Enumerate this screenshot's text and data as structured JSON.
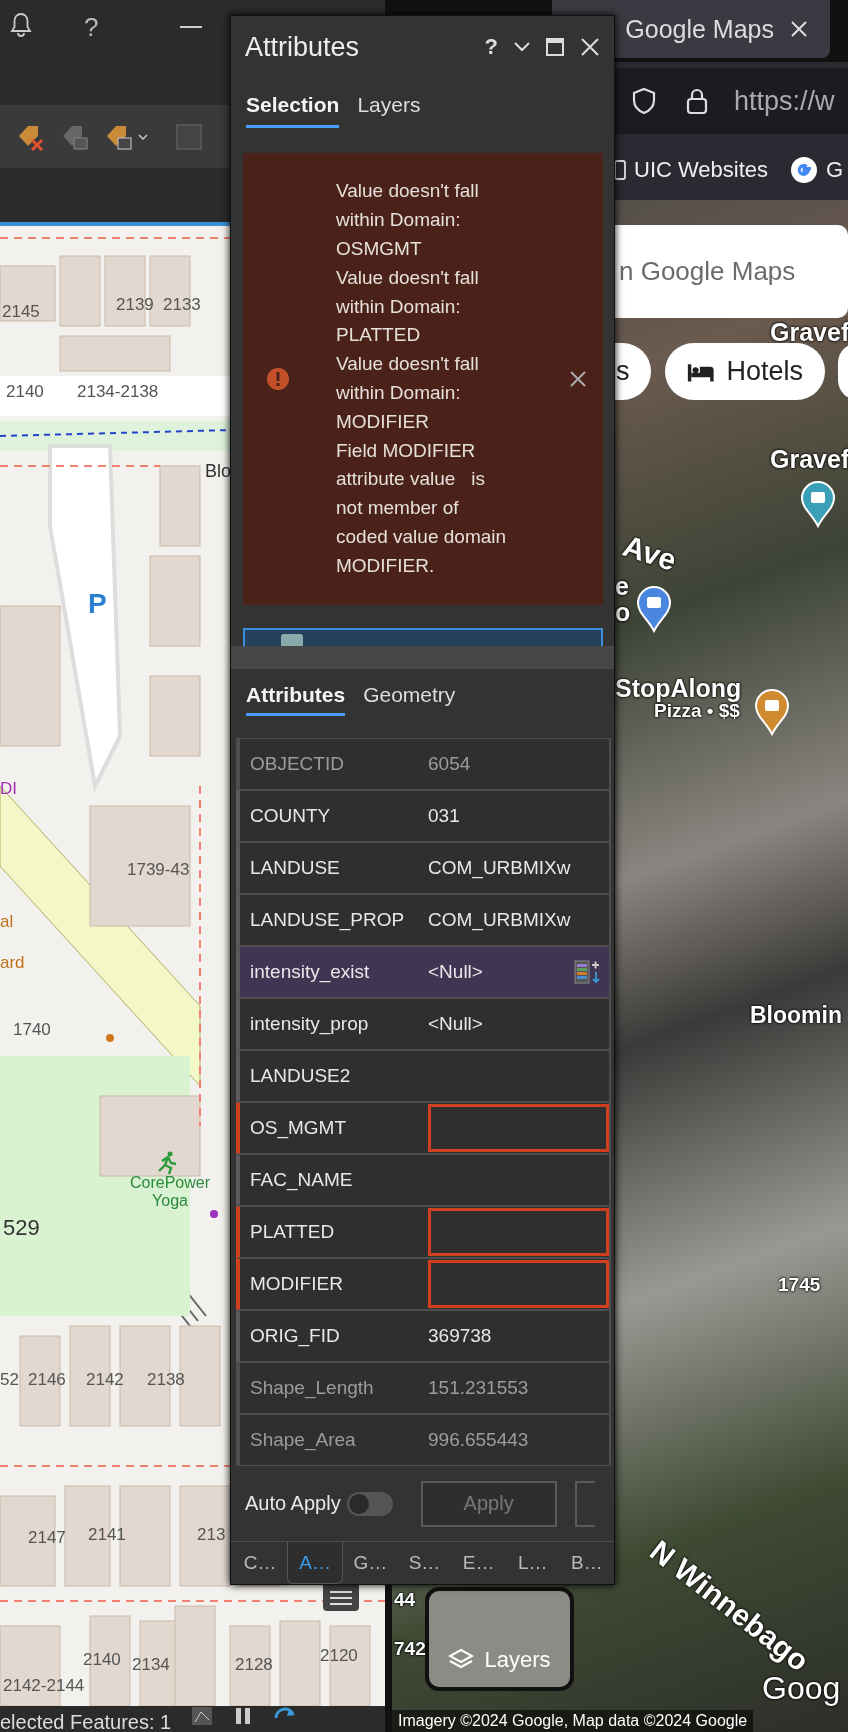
{
  "arcgis_pro": {
    "help": "?",
    "map_labels": [
      {
        "text": "2145",
        "kind": "address"
      },
      {
        "text": "2139",
        "kind": "address"
      },
      {
        "text": "2133",
        "kind": "address"
      },
      {
        "text": "2140",
        "kind": "address"
      },
      {
        "text": "2134-2138",
        "kind": "address"
      },
      {
        "text": "Blo",
        "kind": "road"
      },
      {
        "text": "P",
        "kind": "parking"
      },
      {
        "text": "DI",
        "kind": "store"
      },
      {
        "text": "1739-43",
        "kind": "address"
      },
      {
        "text": "al",
        "kind": "food"
      },
      {
        "text": "ard",
        "kind": "food"
      },
      {
        "text": "1740",
        "kind": "address"
      },
      {
        "text": "CorePower Yoga",
        "kind": "poi"
      },
      {
        "text": "529",
        "kind": "big"
      },
      {
        "text": "52",
        "kind": "address"
      },
      {
        "text": "2146",
        "kind": "address"
      },
      {
        "text": "2142",
        "kind": "address"
      },
      {
        "text": "2138",
        "kind": "address"
      },
      {
        "text": "2147",
        "kind": "address"
      },
      {
        "text": "2141",
        "kind": "address"
      },
      {
        "text": "213",
        "kind": "address"
      },
      {
        "text": "2140",
        "kind": "address"
      },
      {
        "text": "2134",
        "kind": "address"
      },
      {
        "text": "2128",
        "kind": "address"
      },
      {
        "text": "2120",
        "kind": "address"
      },
      {
        "text": "2142-2144",
        "kind": "address"
      }
    ],
    "status_bar": "elected Features: 1"
  },
  "attributes_pane": {
    "title": "Attributes",
    "help": "?",
    "tabs": [
      {
        "label": "Selection",
        "selected": true
      },
      {
        "label": "Layers",
        "selected": false
      }
    ],
    "error": {
      "lines": [
        "Value doesn't fall",
        "within Domain:",
        "OSMGMT",
        "Value doesn't fall",
        "within Domain:",
        "PLATTED",
        "Value doesn't fall",
        "within Domain:",
        "MODIFIER",
        "Field MODIFIER",
        "attribute value   is",
        "not member of",
        "coded value domain",
        "MODIFIER."
      ]
    },
    "detail_tabs": [
      {
        "label": "Attributes",
        "selected": true
      },
      {
        "label": "Geometry",
        "selected": false
      }
    ],
    "fields": [
      {
        "name": "OBJECTID",
        "value": "6054",
        "readonly": true,
        "invalid": false,
        "selected": false
      },
      {
        "name": "COUNTY",
        "value": "031",
        "readonly": false,
        "invalid": false,
        "selected": false
      },
      {
        "name": "LANDUSE",
        "value": "COM_URBMIXw",
        "readonly": false,
        "invalid": false,
        "selected": false
      },
      {
        "name": "LANDUSE_PROP",
        "value": "COM_URBMIXw",
        "readonly": false,
        "invalid": false,
        "selected": false
      },
      {
        "name": "intensity_exist",
        "value": "<Null>",
        "readonly": false,
        "invalid": false,
        "selected": true
      },
      {
        "name": "intensity_prop",
        "value": "<Null>",
        "readonly": false,
        "invalid": false,
        "selected": false
      },
      {
        "name": "LANDUSE2",
        "readonly": false,
        "invalid": false,
        "selected": false
      },
      {
        "name": "OS_MGMT",
        "readonly": false,
        "invalid": true,
        "selected": false
      },
      {
        "name": "FAC_NAME",
        "readonly": false,
        "invalid": false,
        "selected": false
      },
      {
        "name": "PLATTED",
        "readonly": false,
        "invalid": true,
        "selected": false
      },
      {
        "name": "MODIFIER",
        "readonly": false,
        "invalid": true,
        "selected": false
      },
      {
        "name": "ORIG_FID",
        "value": "369738",
        "readonly": false,
        "invalid": false,
        "selected": false
      },
      {
        "name": "Shape_Length",
        "value": "151.231553",
        "readonly": true,
        "invalid": false,
        "selected": false
      },
      {
        "name": "Shape_Area",
        "value": "996.655443",
        "readonly": true,
        "invalid": false,
        "selected": false
      }
    ],
    "auto_apply": {
      "label": "Auto Apply",
      "on": false
    },
    "apply_button": {
      "label": "Apply",
      "disabled": true
    },
    "bottom_tabs": [
      {
        "label": "C…",
        "selected": false
      },
      {
        "label": "A…",
        "selected": true
      },
      {
        "label": "G…",
        "selected": false
      },
      {
        "label": "S…",
        "selected": false
      },
      {
        "label": "E…",
        "selected": false
      },
      {
        "label": "L…",
        "selected": false
      },
      {
        "label": "B…",
        "selected": false
      }
    ]
  },
  "browser": {
    "tab_title": "Google Maps",
    "url": "https://w",
    "bookmarks": [
      "UIC Websites",
      "G"
    ],
    "maps": {
      "search_placeholder": "n Google Maps",
      "chips": [
        "s",
        "Hotels"
      ],
      "labels": [
        {
          "text": "Gravef",
          "kind": "place"
        },
        {
          "text": "Gravef",
          "kind": "place"
        },
        {
          "text": "Ave",
          "kind": "street"
        },
        {
          "text": "e",
          "kind": "place"
        },
        {
          "text": "o",
          "kind": "place"
        },
        {
          "text": "StopAlong",
          "kind": "place"
        },
        {
          "text": "Pizza • $$",
          "kind": "small"
        },
        {
          "text": "Bloomin",
          "kind": "place"
        },
        {
          "text": "1745",
          "kind": "small"
        },
        {
          "text": "N Winnebago",
          "kind": "street"
        },
        {
          "text": "Goog",
          "kind": "logo"
        },
        {
          "text": "44",
          "kind": "small"
        },
        {
          "text": "742",
          "kind": "small"
        }
      ],
      "layers_button": "Layers",
      "attribution": "Imagery ©2024 Google, Map data ©2024 Google"
    }
  }
}
